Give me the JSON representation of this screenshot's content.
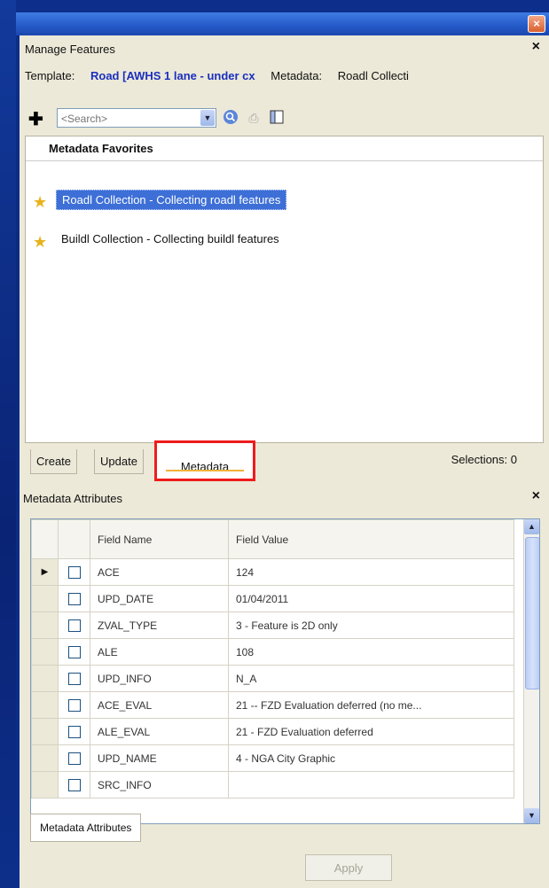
{
  "pane": {
    "title": "Manage Features",
    "close_glyph": "×",
    "template_label": "Template:",
    "template_value": "Road [AWHS 1 lane - under cx",
    "metadata_label": "Metadata:",
    "metadata_value": "Roadl Collecti",
    "search_placeholder": "<Search>"
  },
  "favorites": {
    "header": "Metadata Favorites",
    "items": [
      {
        "label": "Roadl Collection - Collecting roadl features",
        "selected": true
      },
      {
        "label": "Buildl Collection - Collecting buildl features",
        "selected": false
      }
    ]
  },
  "tabs": {
    "create": "Create",
    "update": "Update",
    "metadata": "Metadata",
    "selections": "Selections: 0"
  },
  "attributes": {
    "title": "Metadata Attributes",
    "close_glyph": "×",
    "columns": [
      "Field Name",
      "Field Value"
    ],
    "rows": [
      {
        "name": "ACE",
        "value": "124",
        "current": true
      },
      {
        "name": "UPD_DATE",
        "value": "01/04/2011"
      },
      {
        "name": "ZVAL_TYPE",
        "value": "3 - Feature is 2D only"
      },
      {
        "name": "ALE",
        "value": "108"
      },
      {
        "name": "UPD_INFO",
        "value": "N_A"
      },
      {
        "name": "ACE_EVAL",
        "value": "21 -- FZD Evaluation deferred (no me..."
      },
      {
        "name": "ALE_EVAL",
        "value": "21 - FZD Evaluation deferred"
      },
      {
        "name": "UPD_NAME",
        "value": "4 - NGA City Graphic"
      },
      {
        "name": "SRC_INFO",
        "value": ""
      }
    ],
    "bottom_tab": "Metadata Attributes",
    "apply_label": "Apply"
  },
  "colors": {
    "accent_blue": "#3d6fd6",
    "highlight_red": "#ee1c1c",
    "template_blue": "#1a2fbf"
  }
}
